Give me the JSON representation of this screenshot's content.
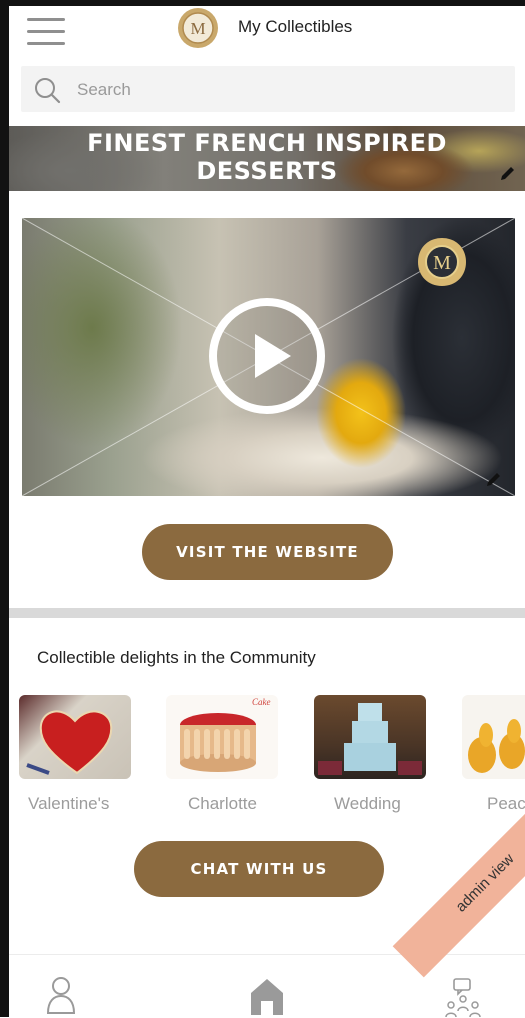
{
  "header": {
    "title": "My Collectibles",
    "logo_letter": "M"
  },
  "search": {
    "placeholder": "Search"
  },
  "banner": {
    "title_line1": "FINEST FRENCH INSPIRED",
    "title_line2": "DESSERTS"
  },
  "video": {
    "badge_letter": "M"
  },
  "visit_button": "VISIT THE WEBSITE",
  "community": {
    "title": "Collectible delights in the Community",
    "items": [
      {
        "label": "Valentine's"
      },
      {
        "label": "Charlotte",
        "image_caption": "Cake"
      },
      {
        "label": "Wedding"
      },
      {
        "label": "Peac"
      }
    ]
  },
  "chat_button": "CHAT WITH US",
  "admin_ribbon": "admin view",
  "bottom_nav": [
    {
      "icon": "profile-icon"
    },
    {
      "icon": "home-icon"
    },
    {
      "icon": "community-chat-icon"
    }
  ],
  "colors": {
    "accent": "#8b6a3f",
    "ribbon": "#f1b39a",
    "label_gray": "#9c9c9c"
  }
}
